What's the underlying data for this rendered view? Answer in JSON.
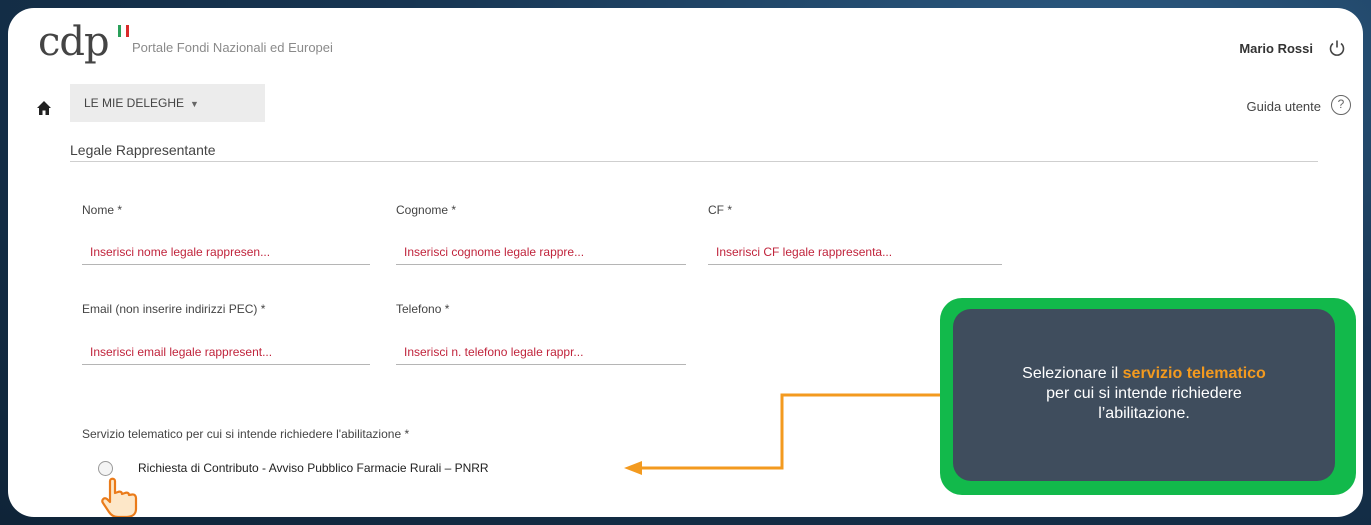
{
  "header": {
    "logo_text": "cdp",
    "portal_title": "Portale Fondi Nazionali ed Europei",
    "user_name": "Mario Rossi"
  },
  "nav": {
    "menu_label": "LE MIE DELEGHE",
    "help_label": "Guida utente",
    "help_glyph": "?"
  },
  "form": {
    "section_title": "Legale Rappresentante",
    "nome": {
      "label": "Nome *",
      "placeholder": "Inserisci nome legale rappresen..."
    },
    "cognome": {
      "label": "Cognome *",
      "placeholder": "Inserisci cognome legale rappre..."
    },
    "cf": {
      "label": "CF *",
      "placeholder": "Inserisci CF legale rappresenta..."
    },
    "email": {
      "label": "Email (non inserire indirizzi PEC) *",
      "placeholder": "Inserisci email legale rappresent..."
    },
    "telefono": {
      "label": "Telefono *",
      "placeholder": "Inserisci n. telefono legale rappr..."
    },
    "servizio": {
      "label": "Servizio telematico per cui si intende richiedere l'abilitazione *",
      "option": "Richiesta di Contributo - Avviso Pubblico Farmacie Rurali – PNRR"
    }
  },
  "callout": {
    "text_before": "Selezionare il ",
    "highlight": "servizio telematico",
    "text_after": "per cui si intende richiedere l’abilitazione."
  },
  "icons": {
    "power": "power-icon",
    "home": "home-icon",
    "help": "help-circle-icon",
    "hand": "pointing-hand-icon",
    "flag": "italian-flag-icon"
  },
  "colors": {
    "required_placeholder": "#c0243c",
    "callout_border": "#12b94b",
    "callout_fill": "#3f4d5d",
    "highlight": "#f39a1f",
    "arrow": "#f39a1f"
  }
}
